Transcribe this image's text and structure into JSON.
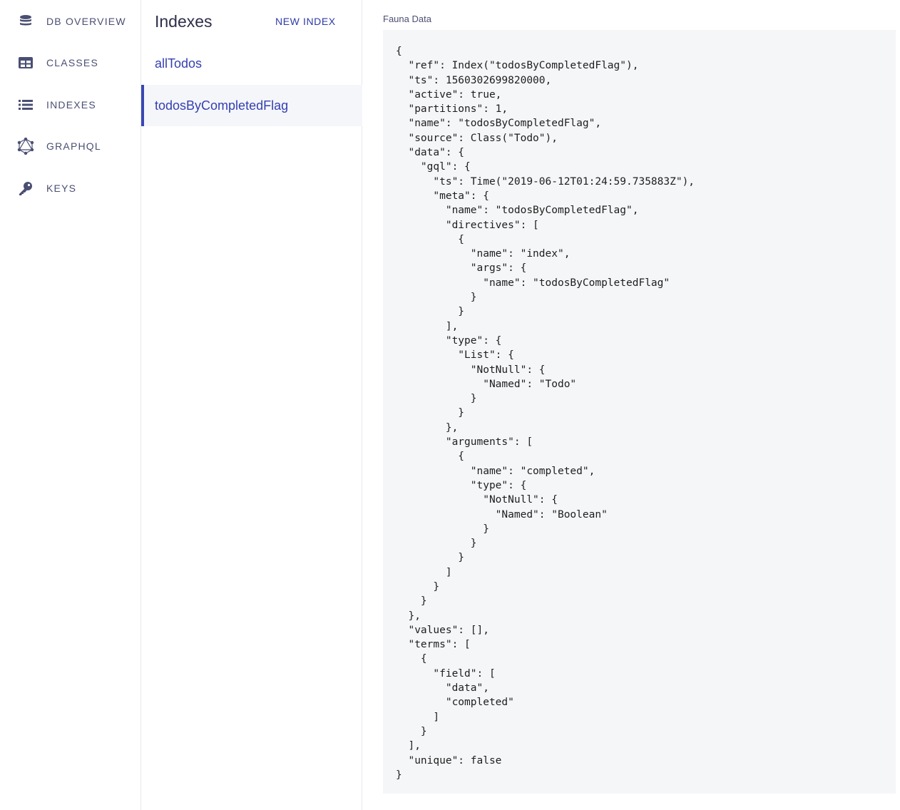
{
  "nav": {
    "items": [
      {
        "label": "DB OVERVIEW",
        "icon": "database-icon"
      },
      {
        "label": "CLASSES",
        "icon": "table-icon"
      },
      {
        "label": "INDEXES",
        "icon": "list-icon"
      },
      {
        "label": "GRAPHQL",
        "icon": "graphql-icon"
      },
      {
        "label": "KEYS",
        "icon": "key-icon"
      }
    ]
  },
  "list": {
    "title": "Indexes",
    "new_button": "NEW INDEX",
    "items": [
      "allTodos",
      "todosByCompletedFlag"
    ],
    "active": "todosByCompletedFlag"
  },
  "content": {
    "label": "Fauna Data",
    "code": [
      "{",
      "  \"ref\": Index(\"todosByCompletedFlag\"),",
      "  \"ts\": 1560302699820000,",
      "  \"active\": true,",
      "  \"partitions\": 1,",
      "  \"name\": \"todosByCompletedFlag\",",
      "  \"source\": Class(\"Todo\"),",
      "  \"data\": {",
      "    \"gql\": {",
      "      \"ts\": Time(\"2019-06-12T01:24:59.735883Z\"),",
      "      \"meta\": {",
      "        \"name\": \"todosByCompletedFlag\",",
      "        \"directives\": [",
      "          {",
      "            \"name\": \"index\",",
      "            \"args\": {",
      "              \"name\": \"todosByCompletedFlag\"",
      "            }",
      "          }",
      "        ],",
      "        \"type\": {",
      "          \"List\": {",
      "            \"NotNull\": {",
      "              \"Named\": \"Todo\"",
      "            }",
      "          }",
      "        },",
      "        \"arguments\": [",
      "          {",
      "            \"name\": \"completed\",",
      "            \"type\": {",
      "              \"NotNull\": {",
      "                \"Named\": \"Boolean\"",
      "              }",
      "            }",
      "          }",
      "        ]",
      "      }",
      "    }",
      "  },",
      "  \"values\": [],",
      "  \"terms\": [",
      "    {",
      "      \"field\": [",
      "        \"data\",",
      "        \"completed\"",
      "      ]",
      "    }",
      "  ],",
      "  \"unique\": false",
      "}"
    ]
  },
  "colors": {
    "accent": "#3a47b3",
    "nav_icon": "#4a4f73",
    "code_bg": "#f5f6f8"
  }
}
